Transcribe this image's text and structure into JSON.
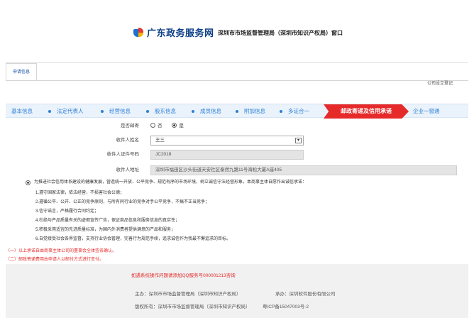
{
  "header": {
    "site_title": "广东政务服务网",
    "window_title": "深圳市市场监督管理局（深圳市知识产权局）窗口"
  },
  "tabs": {
    "active_label": "申请信息",
    "page_subtitle": "公司设立登记"
  },
  "steps": [
    "基本信息",
    "法定代表人",
    "经营信息",
    "股东信息",
    "成员信息",
    "附加信息",
    "多证合一",
    "邮政寄递及信用承诺",
    "企业一窗通"
  ],
  "form": {
    "mail_label": "是否邮寄",
    "mail_options": [
      "否",
      "是"
    ],
    "mail_selected": "是",
    "recipient_label": "收件人姓名",
    "recipient_value": "王三",
    "id_label": "收件人证件号码",
    "id_value": "JC2018",
    "address_label": "收件人地址",
    "address_value": "深圳市福田区沙头街道天安社区泰然九路11号海松大厦A座405"
  },
  "promise": {
    "intro": "为推进社会信用体系建设的健康发展，营造统一开放、公平竞争、规范有序的市场环境，树立诚信守法经营形象，本商事主体自愿作出诚信承诺：",
    "items": [
      "1.遵守国家法律，依法经营，不损害社会公德；",
      "2.遵循公平、公开、公正的竞争原则，与所有同行业的竞争对手公平竞争，不搞不正当竞争；",
      "3.信守诺言，严格履行合同约定；",
      "4.杜绝与产品质量有关的虚假宣传广告，保证商品信息和服务信息的真实性；",
      "5.积极采用适宜的先进质量标准，为国内外消费者提供满意的产品和服务；",
      "6.自觉接受社会各界监督，支持行业协会管理，完善行为规范手续，追求诚信作为我最不懈追求的目标。"
    ]
  },
  "notes": [
    "（一）以上承诺自由商事主体公司的董事会全体签名确认。",
    "（二）邮政寄递费用由申请人以邮付方式进行支付。"
  ],
  "footer": {
    "notice": "如遇系统操作问题请添加QQ服务号000001213咨询",
    "host_label": "主办：深圳市市场监督管理局（深圳市知识产权局）",
    "tech_label": "承办：深圳软件股份有限公司",
    "copyright": "版权所有：深圳市市场监督管理局（深圳市知识产权局）",
    "icp": "粤ICP备15047003号-2"
  },
  "colors": {
    "brand_blue": "#0c3f88",
    "step_blue": "#2b7fd6",
    "active_red": "#e62a2a"
  }
}
